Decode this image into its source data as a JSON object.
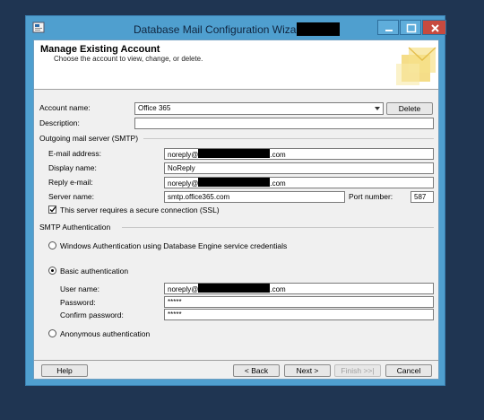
{
  "window": {
    "title": "Database Mail Configuration Wizard -"
  },
  "header": {
    "title": "Manage Existing Account",
    "subtitle": "Choose the account to view, change, or delete."
  },
  "account": {
    "name_label": "Account name:",
    "name_value": "Office 365",
    "delete_label": "Delete",
    "description_label": "Description:",
    "description_value": ""
  },
  "smtp": {
    "section_label": "Outgoing mail server (SMTP)",
    "email_label": "E-mail address:",
    "email_prefix": "noreply@",
    "email_suffix": ".com",
    "display_label": "Display name:",
    "display_value": "NoReply",
    "reply_label": "Reply e-mail:",
    "reply_prefix": "noreply@",
    "reply_suffix": ".com",
    "server_label": "Server name:",
    "server_value": "smtp.office365.com",
    "port_label": "Port number:",
    "port_value": "587",
    "ssl_label": "This server requires a secure connection (SSL)",
    "ssl_checked": true
  },
  "auth": {
    "section_label": "SMTP Authentication",
    "windows_label": "Windows Authentication using Database Engine service credentials",
    "basic_label": "Basic authentication",
    "username_label": "User name:",
    "username_prefix": "noreply@",
    "username_suffix": ".com",
    "password_label": "Password:",
    "password_value": "*****",
    "confirm_label": "Confirm password:",
    "confirm_value": "*****",
    "anonymous_label": "Anonymous authentication",
    "selected": "basic"
  },
  "footer": {
    "help": "Help",
    "back": "< Back",
    "next": "Next >",
    "finish": "Finish >>|",
    "cancel": "Cancel"
  },
  "colors": {
    "desktop": "#1f3552",
    "frame": "#4f9fcf",
    "close": "#c74a3f"
  }
}
